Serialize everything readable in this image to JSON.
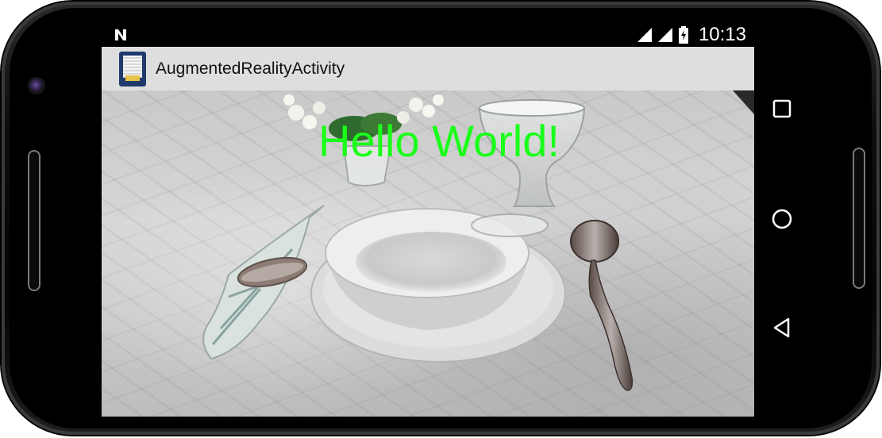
{
  "status_bar": {
    "notification_icon": "n-icon",
    "signal_icons": [
      "signal-icon",
      "signal-icon"
    ],
    "battery_icon": "battery-icon",
    "time": "10:13"
  },
  "app_bar": {
    "icon": "app-icon",
    "title": "AugmentedRealityActivity"
  },
  "camera_view": {
    "overlay_text": "Hello World!",
    "overlay_color": "#1aff1a"
  },
  "nav_bar": {
    "recents_icon": "recents-icon",
    "home_icon": "home-icon",
    "back_icon": "back-icon"
  },
  "colors": {
    "app_bar_bg": "#dedede",
    "status_bar_bg": "#000000",
    "device_frame": "#0d0d0d"
  }
}
